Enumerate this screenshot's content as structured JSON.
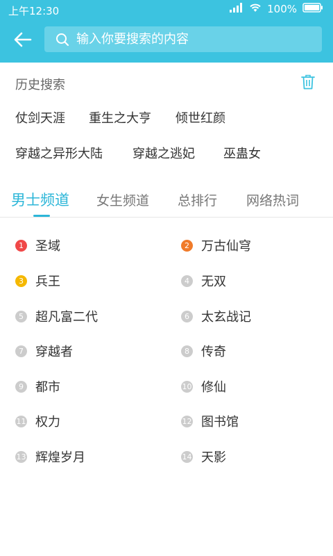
{
  "status_bar": {
    "time": "上午12:30",
    "battery": "100%"
  },
  "header": {
    "search_placeholder": "输入你要搜索的内容"
  },
  "history": {
    "title": "历史搜索",
    "tags": [
      "仗剑天涯",
      "重生之大亨",
      "倾世红颜",
      "穿越之异形大陆",
      "穿越之逃妃",
      "巫蛊女"
    ]
  },
  "tabs": [
    "男士频道",
    "女生频道",
    "总排行",
    "网络热词"
  ],
  "active_tab_index": 0,
  "colors": {
    "accent": "#3cc3e0",
    "rank1": "#f04848",
    "rank2": "#f07b2a",
    "rank3": "#f5b800",
    "rank_other": "#cccccc"
  },
  "ranks": [
    {
      "num": "1",
      "label": "圣域"
    },
    {
      "num": "2",
      "label": "万古仙穹"
    },
    {
      "num": "3",
      "label": "兵王"
    },
    {
      "num": "4",
      "label": "无双"
    },
    {
      "num": "5",
      "label": "超凡富二代"
    },
    {
      "num": "6",
      "label": "太玄战记"
    },
    {
      "num": "7",
      "label": "穿越者"
    },
    {
      "num": "8",
      "label": "传奇"
    },
    {
      "num": "9",
      "label": "都市"
    },
    {
      "num": "10",
      "label": "修仙"
    },
    {
      "num": "11",
      "label": "权力"
    },
    {
      "num": "12",
      "label": "图书馆"
    },
    {
      "num": "13",
      "label": "辉煌岁月"
    },
    {
      "num": "14",
      "label": "天影"
    }
  ]
}
